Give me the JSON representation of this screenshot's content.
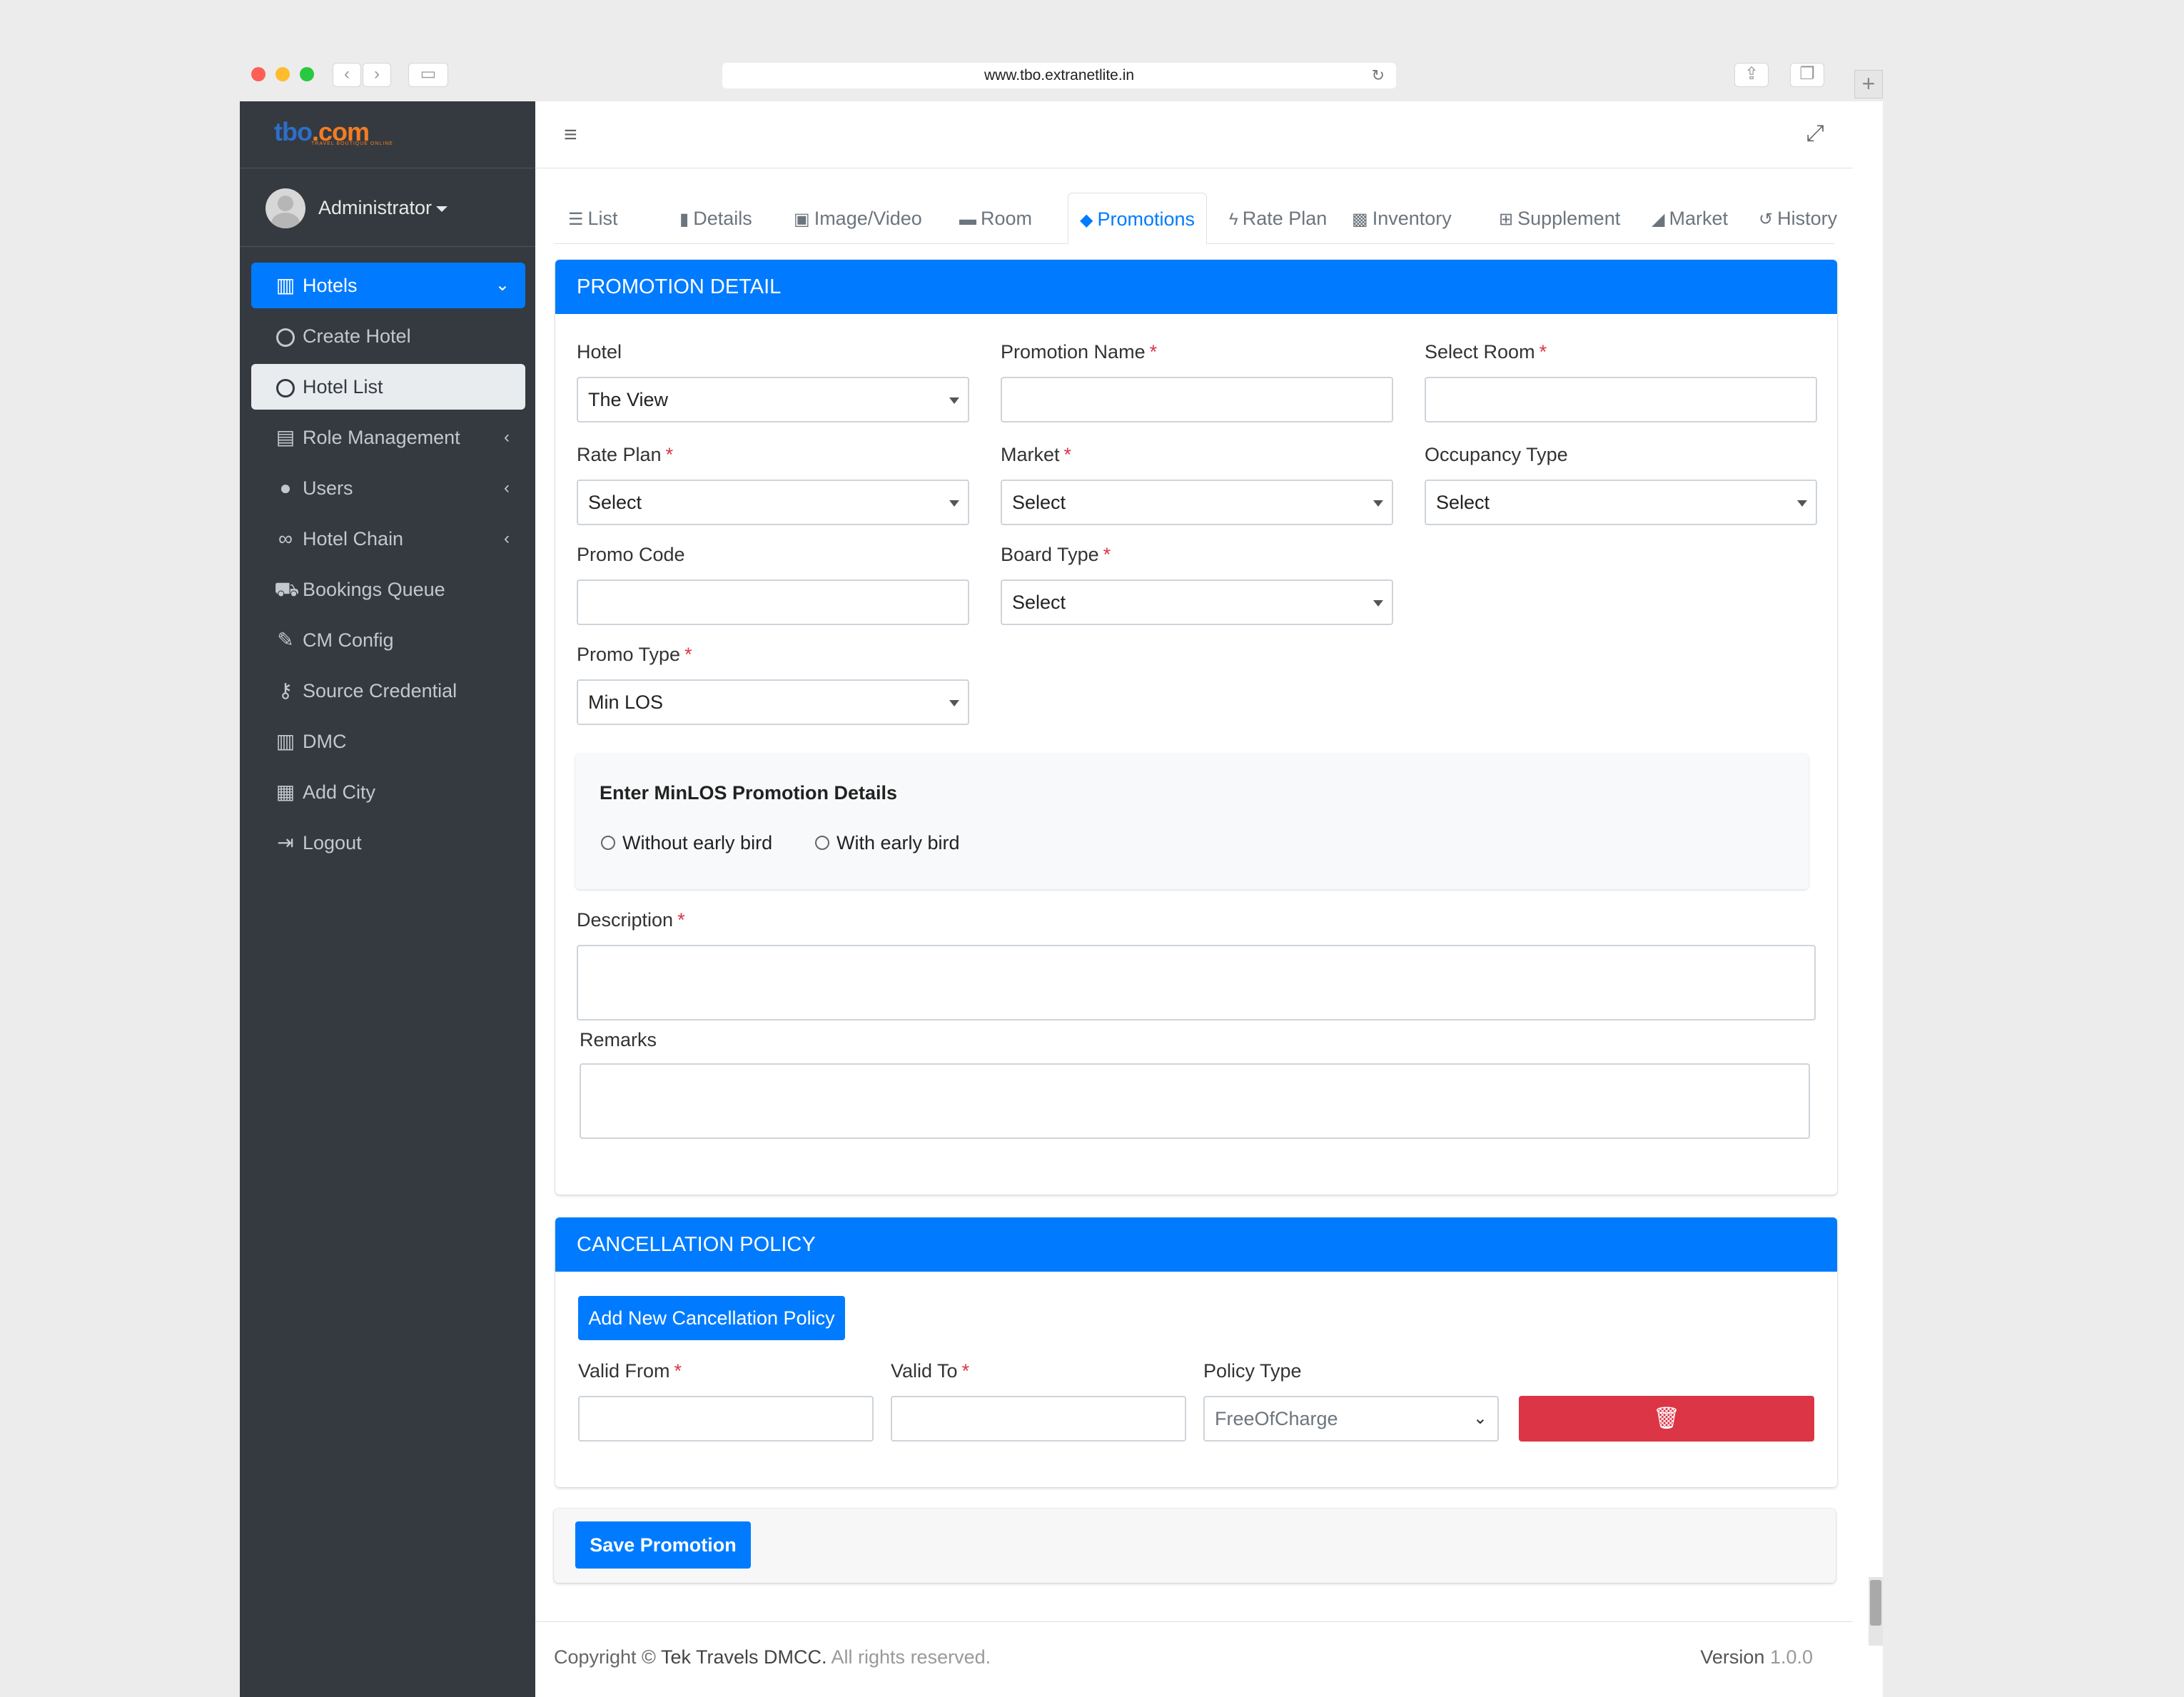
{
  "browser": {
    "url": "www.tbo.extranetlite.in"
  },
  "brand": {
    "name": "tbo",
    "suffix": ".com",
    "tagline": "TRAVEL BOUTIQUE ONLINE"
  },
  "user": {
    "name": "Administrator"
  },
  "sidebar": {
    "items": [
      {
        "label": "Hotels",
        "icon": "building-icon"
      },
      {
        "label": "Create Hotel",
        "icon": "circle-icon"
      },
      {
        "label": "Hotel List",
        "icon": "circle-icon"
      },
      {
        "label": "Role Management",
        "icon": "clipboard-icon"
      },
      {
        "label": "Users",
        "icon": "user-icon"
      },
      {
        "label": "Hotel Chain",
        "icon": "link-icon"
      },
      {
        "label": "Bookings Queue",
        "icon": "cart-icon"
      },
      {
        "label": "CM Config",
        "icon": "brush-icon"
      },
      {
        "label": "Source Credential",
        "icon": "key-icon"
      },
      {
        "label": "DMC",
        "icon": "building-icon"
      },
      {
        "label": "Add City",
        "icon": "city-icon"
      },
      {
        "label": "Logout",
        "icon": "logout-icon"
      }
    ]
  },
  "tabs": [
    {
      "label": "List",
      "icon": "list-icon"
    },
    {
      "label": "Details",
      "icon": "file-icon"
    },
    {
      "label": "Image/Video",
      "icon": "image-icon"
    },
    {
      "label": "Room",
      "icon": "bed-icon"
    },
    {
      "label": "Promotions",
      "icon": "tags-icon"
    },
    {
      "label": "Rate Plan",
      "icon": "bolt-icon"
    },
    {
      "label": "Inventory",
      "icon": "boxes-icon"
    },
    {
      "label": "Supplement",
      "icon": "plus-square-icon"
    },
    {
      "label": "Market",
      "icon": "chart-area-icon"
    },
    {
      "label": "History",
      "icon": "history-icon"
    }
  ],
  "promotion": {
    "header": "PROMOTION DETAIL",
    "hotel_label": "Hotel",
    "hotel_value": "The View",
    "promotion_name_label": "Promotion Name",
    "select_room_label": "Select Room",
    "rate_plan_label": "Rate Plan",
    "rate_plan_value": "Select",
    "market_label": "Market",
    "market_value": "Select",
    "occupancy_label": "Occupancy Type",
    "occupancy_value": "Select",
    "promo_code_label": "Promo Code",
    "board_type_label": "Board Type",
    "board_type_value": "Select",
    "promo_type_label": "Promo Type",
    "promo_type_value": "Min LOS",
    "minlos_title": "Enter MinLOS Promotion Details",
    "radio_without": "Without early bird",
    "radio_with": "With early bird",
    "description_label": "Description",
    "remarks_label": "Remarks",
    "required_mark": "*"
  },
  "cancellation": {
    "header": "CANCELLATION POLICY",
    "add_button": "Add New Cancellation Policy",
    "valid_from_label": "Valid From",
    "valid_to_label": "Valid To",
    "policy_type_label": "Policy Type",
    "policy_type_value": "FreeOfCharge"
  },
  "save_button": "Save Promotion",
  "footer": {
    "copyright": "Copyright ©",
    "company": "Tek Travels DMCC.",
    "rights": "All rights reserved.",
    "version_label": "Version",
    "version_value": "1.0.0"
  },
  "colors": {
    "primary": "#007bff",
    "danger": "#dc3545",
    "sidebar": "#343a40",
    "brand_blue": "#2d6ec8",
    "brand_orange": "#f57c22"
  }
}
